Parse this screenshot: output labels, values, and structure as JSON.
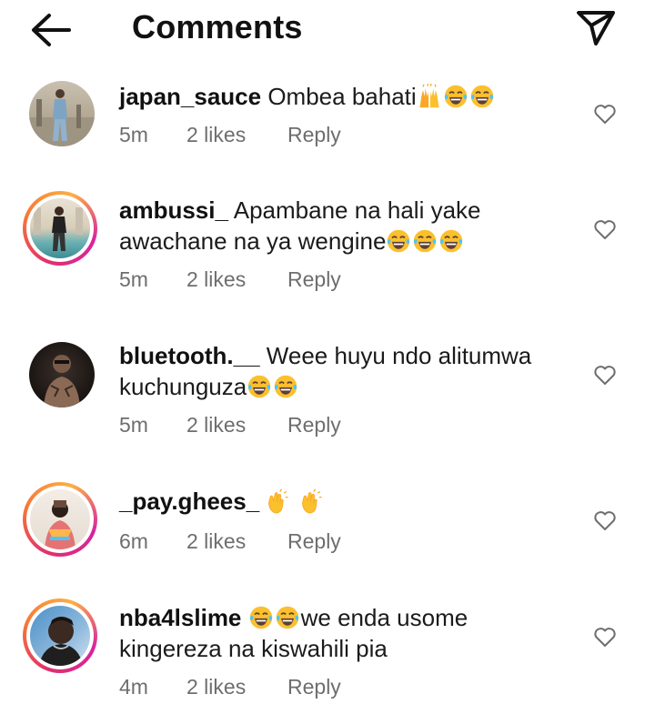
{
  "header": {
    "title": "Comments"
  },
  "comments": [
    {
      "username": "japan_sauce",
      "text_lines": [
        "Ombea bahati"
      ],
      "time": "5m",
      "likes": "2 likes",
      "reply": "Reply"
    },
    {
      "username": "ambussi_",
      "text_lines": [
        "Apambane na hali yake",
        "awachane na ya wengine"
      ],
      "time": "5m",
      "likes": "2 likes",
      "reply": "Reply"
    },
    {
      "username": "bluetooth.__",
      "text_lines": [
        "Weee huyu ndo alitumwa",
        "kuchunguza"
      ],
      "time": "5m",
      "likes": "2 likes",
      "reply": "Reply"
    },
    {
      "username": "_pay.ghees_",
      "text_lines": [
        ""
      ],
      "time": "6m",
      "likes": "2 likes",
      "reply": "Reply"
    },
    {
      "username": "nba4lslime",
      "text_lines": [
        "we enda usome",
        "kingereza na kiswahili pia"
      ],
      "time": "4m",
      "likes": "2 likes",
      "reply": "Reply"
    }
  ],
  "icons": {
    "back": "arrow-left-icon",
    "share": "paper-plane-icon",
    "like": "heart-outline-icon",
    "emoji_laugh": "face-with-tears-of-joy-emoji",
    "emoji_hands": "raising-hands-emoji",
    "emoji_clap": "clapping-hands-emoji"
  },
  "colors": {
    "meta_text": "#6e6e6e",
    "story_ring": "#e1306c",
    "emoji_yellow": "#fbc02d"
  }
}
